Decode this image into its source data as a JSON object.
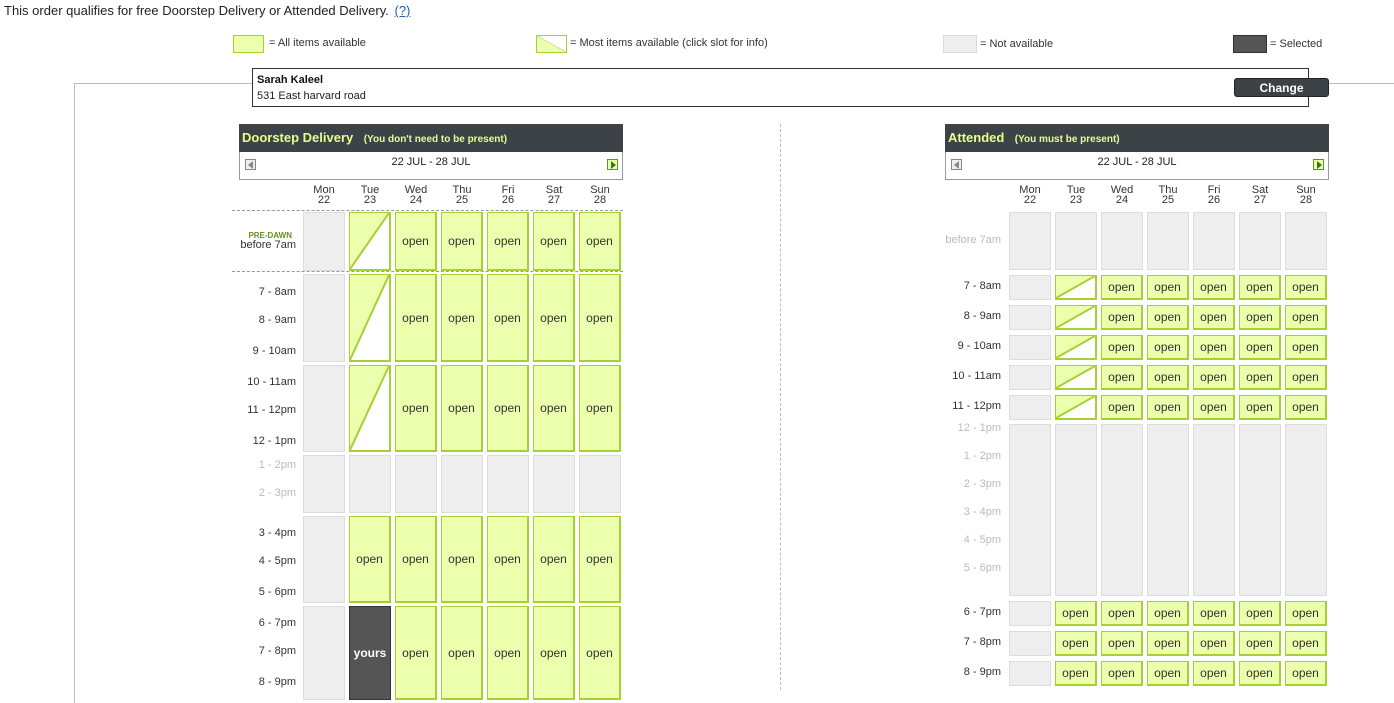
{
  "notice": {
    "text": "This order qualifies for free Doorstep Delivery or Attended Delivery.",
    "help": "(?)"
  },
  "legend": [
    {
      "label": "= All items available"
    },
    {
      "label": "= Most items available (click slot for info)"
    },
    {
      "label": "= Not available"
    },
    {
      "label": "= Selected"
    }
  ],
  "address": {
    "name": "Sarah Kaleel",
    "line": "531 East harvard road",
    "change_label": "Change"
  },
  "days": [
    {
      "dow": "Mon",
      "date": "22"
    },
    {
      "dow": "Tue",
      "date": "23"
    },
    {
      "dow": "Wed",
      "date": "24"
    },
    {
      "dow": "Thu",
      "date": "25"
    },
    {
      "dow": "Fri",
      "date": "26"
    },
    {
      "dow": "Sat",
      "date": "27"
    },
    {
      "dow": "Sun",
      "date": "28"
    }
  ],
  "doorstep": {
    "title": "Doorstep Delivery",
    "subtitle": "(You don't need to be present)",
    "date_range": "22 JUL - 28 JUL",
    "predawn_label": "PRE-DAWN",
    "time_labels": [
      "before 7am",
      "7 - 8am",
      "8 - 9am",
      "9 - 10am",
      "10 - 11am",
      "11 - 12pm",
      "12 - 1pm",
      "1 - 2pm",
      "2 - 3pm",
      "3 - 4pm",
      "4 - 5pm",
      "5 - 6pm",
      "6 - 7pm",
      "7 - 8pm",
      "8 - 9pm"
    ],
    "blocks": [
      [
        "na",
        "most",
        "open",
        "open",
        "open",
        "open",
        "open"
      ],
      [
        "na",
        "most",
        "open",
        "open",
        "open",
        "open",
        "open"
      ],
      [
        "na",
        "most",
        "open",
        "open",
        "open",
        "open",
        "open"
      ],
      [
        "na",
        "na",
        "na",
        "na",
        "na",
        "na",
        "na"
      ],
      [
        "na",
        "open",
        "open",
        "open",
        "open",
        "open",
        "open"
      ],
      [
        "na",
        "yours",
        "open",
        "open",
        "open",
        "open",
        "open"
      ]
    ]
  },
  "attended": {
    "title": "Attended",
    "subtitle": "(You must be present)",
    "date_range": "22 JUL - 28 JUL",
    "time_labels": [
      "before 7am",
      "7 - 8am",
      "8 - 9am",
      "9 - 10am",
      "10 - 11am",
      "11 - 12pm",
      "12 - 1pm",
      "1 - 2pm",
      "2 - 3pm",
      "3 - 4pm",
      "4 - 5pm",
      "5 - 6pm",
      "6 - 7pm",
      "7 - 8pm",
      "8 - 9pm"
    ],
    "blocks": [
      [
        "na",
        "na",
        "na",
        "na",
        "na",
        "na",
        "na"
      ],
      [
        "na",
        "most",
        "open",
        "open",
        "open",
        "open",
        "open"
      ],
      [
        "na",
        "most",
        "open",
        "open",
        "open",
        "open",
        "open"
      ],
      [
        "na",
        "most",
        "open",
        "open",
        "open",
        "open",
        "open"
      ],
      [
        "na",
        "most",
        "open",
        "open",
        "open",
        "open",
        "open"
      ],
      [
        "na",
        "most",
        "open",
        "open",
        "open",
        "open",
        "open"
      ],
      [
        "na",
        "na",
        "na",
        "na",
        "na",
        "na",
        "na"
      ],
      [
        "na",
        "open",
        "open",
        "open",
        "open",
        "open",
        "open"
      ],
      [
        "na",
        "open",
        "open",
        "open",
        "open",
        "open",
        "open"
      ],
      [
        "na",
        "open",
        "open",
        "open",
        "open",
        "open",
        "open"
      ]
    ]
  },
  "slot_text": {
    "open": "open",
    "yours": "yours"
  },
  "colors": {
    "header_bg": "#3d4247",
    "header_text": "#e6ff8c",
    "open_bg": "#ebffad",
    "open_border": "#a6d033",
    "na_bg": "#eeeeee",
    "selected_bg": "#555555"
  }
}
